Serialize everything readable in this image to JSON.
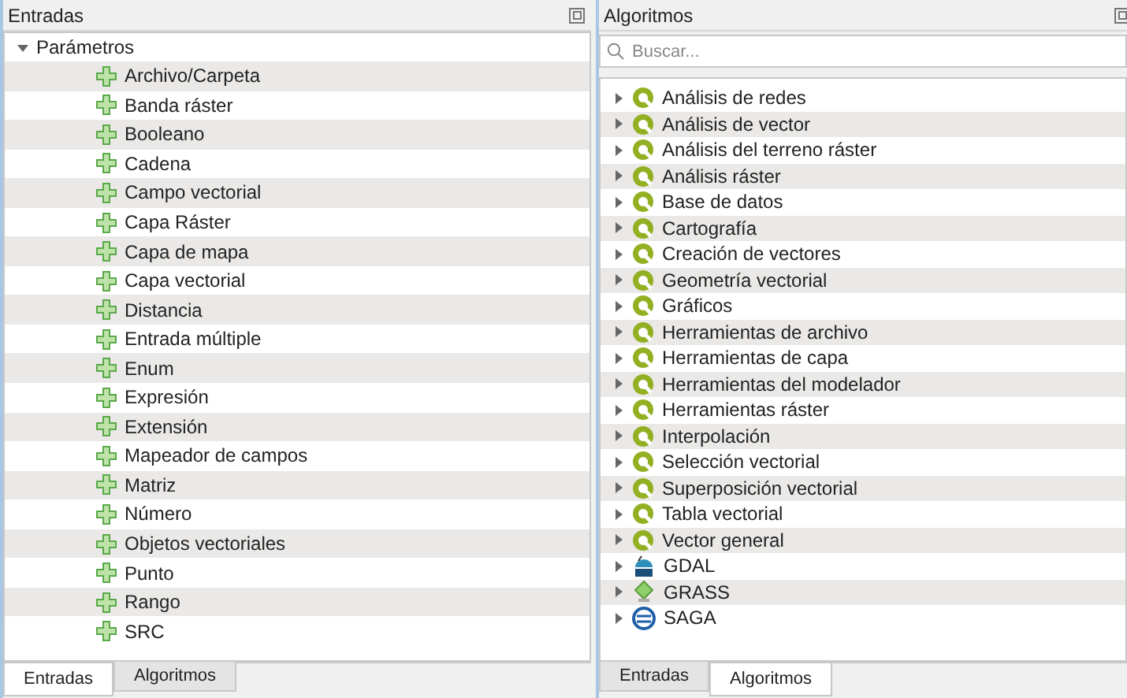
{
  "inputs_panel": {
    "title": "Entradas",
    "tree": {
      "label": "Parámetros",
      "expanded": true,
      "children": [
        {
          "label": "Archivo/Carpeta"
        },
        {
          "label": "Banda ráster"
        },
        {
          "label": "Booleano"
        },
        {
          "label": "Cadena"
        },
        {
          "label": "Campo vectorial"
        },
        {
          "label": "Capa Ráster"
        },
        {
          "label": "Capa de mapa"
        },
        {
          "label": "Capa vectorial"
        },
        {
          "label": "Distancia"
        },
        {
          "label": "Entrada múltiple"
        },
        {
          "label": "Enum"
        },
        {
          "label": "Expresión"
        },
        {
          "label": "Extensión"
        },
        {
          "label": "Mapeador de campos"
        },
        {
          "label": "Matriz"
        },
        {
          "label": "Número"
        },
        {
          "label": "Objetos vectoriales"
        },
        {
          "label": "Punto"
        },
        {
          "label": "Rango"
        },
        {
          "label": "SRC"
        }
      ]
    },
    "tabs": [
      {
        "label": "Entradas",
        "selected": true
      },
      {
        "label": "Algoritmos",
        "selected": false
      }
    ]
  },
  "algorithms_panel": {
    "title": "Algoritmos",
    "search": {
      "placeholder": "Buscar..."
    },
    "items": [
      {
        "label": "Análisis de redes",
        "kind": "qgis",
        "expanded": false
      },
      {
        "label": "Análisis de vector",
        "kind": "qgis",
        "expanded": false
      },
      {
        "label": "Análisis del terreno ráster",
        "kind": "qgis",
        "expanded": false
      },
      {
        "label": "Análisis ráster",
        "kind": "qgis",
        "expanded": false
      },
      {
        "label": "Base de datos",
        "kind": "qgis",
        "expanded": false
      },
      {
        "label": "Cartografía",
        "kind": "qgis",
        "expanded": false
      },
      {
        "label": "Creación de vectores",
        "kind": "qgis",
        "expanded": false
      },
      {
        "label": "Geometría vectorial",
        "kind": "qgis",
        "expanded": false
      },
      {
        "label": "Gráficos",
        "kind": "qgis",
        "expanded": false
      },
      {
        "label": "Herramientas de archivo",
        "kind": "qgis",
        "expanded": false
      },
      {
        "label": "Herramientas de capa",
        "kind": "qgis",
        "expanded": false
      },
      {
        "label": "Herramientas del modelador",
        "kind": "qgis",
        "expanded": false
      },
      {
        "label": "Herramientas ráster",
        "kind": "qgis",
        "expanded": false
      },
      {
        "label": "Interpolación",
        "kind": "qgis",
        "expanded": false
      },
      {
        "label": "Selección vectorial",
        "kind": "qgis",
        "expanded": false
      },
      {
        "label": "Superposición vectorial",
        "kind": "qgis",
        "expanded": false
      },
      {
        "label": "Tabla vectorial",
        "kind": "qgis",
        "expanded": false
      },
      {
        "label": "Vector general",
        "kind": "qgis",
        "expanded": false
      },
      {
        "label": "GDAL",
        "kind": "gdal",
        "expanded": false
      },
      {
        "label": "GRASS",
        "kind": "grass",
        "expanded": false
      },
      {
        "label": "SAGA",
        "kind": "saga",
        "expanded": false
      }
    ],
    "tabs": [
      {
        "label": "Entradas",
        "selected": false
      },
      {
        "label": "Algoritmos",
        "selected": true
      }
    ]
  }
}
